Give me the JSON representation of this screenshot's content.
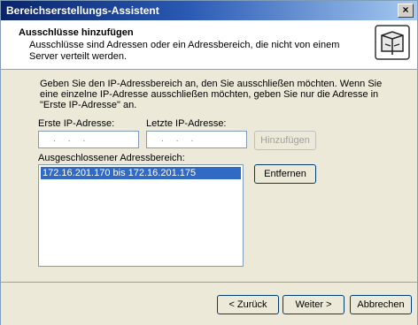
{
  "window": {
    "title": "Bereichserstellungs-Assistent",
    "close_label": "×"
  },
  "header": {
    "title": "Ausschlüsse hinzufügen",
    "subtitle": "Ausschlüsse sind Adressen oder ein Adressbereich, die nicht von einem Server verteilt werden.",
    "icon": "wizard-folder-icon"
  },
  "content": {
    "intro": "Geben Sie den IP-Adressbereich an, den Sie ausschließen möchten. Wenn Sie eine einzelne IP-Adresse ausschließen möchten, geben Sie nur die Adresse in \"Erste IP-Adresse\" an.",
    "first_ip_label": "Erste IP-Adresse:",
    "last_ip_label": "Letzte IP-Adresse:",
    "first_ip_value": "...",
    "last_ip_value": "...",
    "add_button": "Hinzufügen",
    "excluded_label": "Ausgeschlossener Adressbereich:",
    "excluded_items": [
      "172.16.201.170 bis 172.16.201.175"
    ],
    "remove_button": "Entfernen"
  },
  "footer": {
    "back": "< Zurück",
    "next": "Weiter >",
    "cancel": "Abbrechen"
  }
}
